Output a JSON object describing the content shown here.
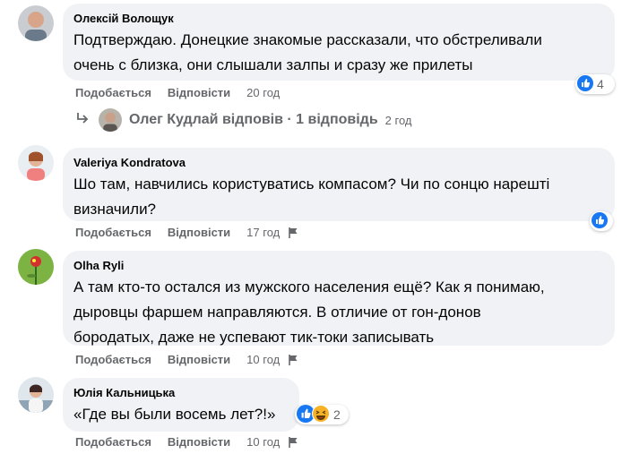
{
  "actions": {
    "like": "Подобається",
    "reply": "Відповісти"
  },
  "colors": {
    "bubble": "#f0f2f5",
    "meta": "#65676b",
    "like_blue": "#1877f2"
  },
  "comments": [
    {
      "author": "Олексій Волощук",
      "lines": [
        "Подтверждаю. Донецкие знакомые рассказали, что обстреливали",
        "очень с близка, они слышали залпы и сразу же прилеты"
      ],
      "time": "20 год",
      "reactions": {
        "icons": [
          "like-icon"
        ],
        "count": "4"
      }
    },
    {
      "author": "Valeriya Kondratova",
      "lines": [
        "Шо там, навчились користуватись компасом? Чи по сонцю нарешті",
        "визначили?"
      ],
      "time": "17 год",
      "reactions": {
        "icons": [
          "like-icon"
        ],
        "count": ""
      }
    },
    {
      "author": "Olha Ryli",
      "lines": [
        "А там кто-то остался из мужского населения ещё? Как я понимаю,",
        "дыровцы фаршем направляются. В отличие от гон-донов",
        "бородатых, даже не успевают тик-токи записывать"
      ],
      "time": "10 год",
      "reactions": {
        "icons": [],
        "count": ""
      }
    },
    {
      "author": "Юлія Кальницька",
      "lines": [
        "«Где вы были восемь лет?!»"
      ],
      "time": "10 год",
      "reactions": {
        "icons": [
          "like-icon",
          "haha-icon"
        ],
        "count": "2"
      }
    }
  ],
  "reply_thread": {
    "text": "Олег Кудлай відповів · 1 відповідь",
    "time": "2 год"
  }
}
